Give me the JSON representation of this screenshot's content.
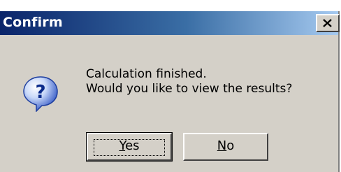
{
  "window": {
    "title": "Confirm",
    "close_icon": "close-icon",
    "titlebar_colors": [
      "#0a246a",
      "#3a6ea5",
      "#a6caf0"
    ],
    "face_color": "#d4d0c8"
  },
  "message": {
    "icon": "question-icon",
    "line1": "Calculation finished.",
    "line2": "Would you like to view the results?"
  },
  "buttons": {
    "yes": {
      "mnemonic": "Y",
      "rest": "es",
      "focused": true
    },
    "no": {
      "mnemonic": "N",
      "rest": "o"
    }
  }
}
